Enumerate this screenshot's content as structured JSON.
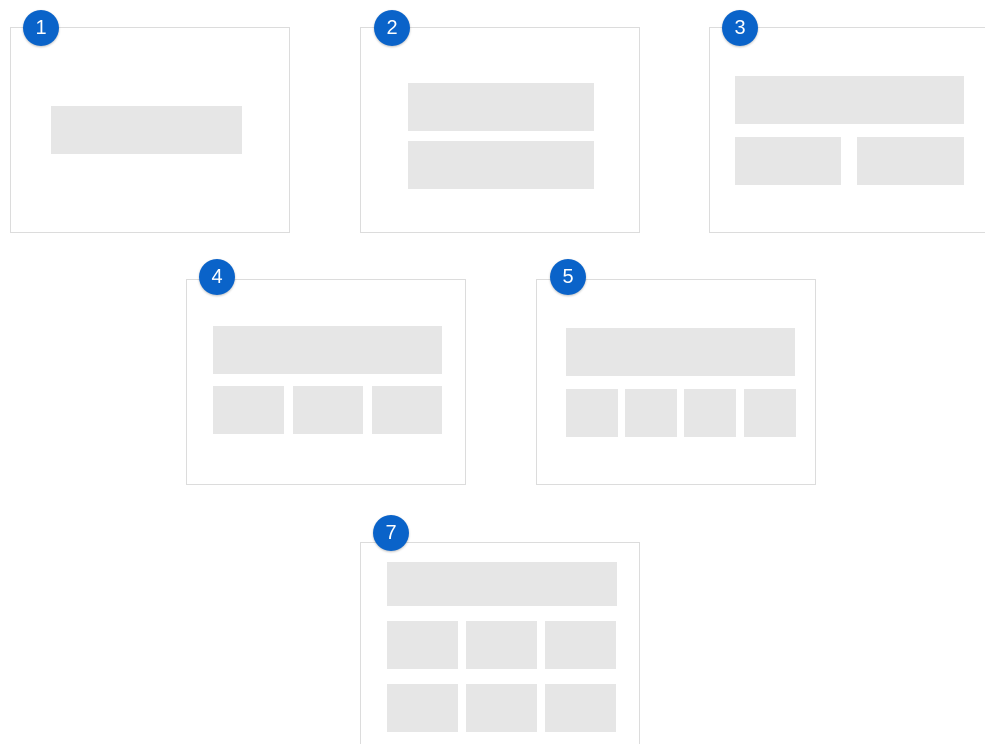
{
  "colors": {
    "badge": "#0a63c9",
    "badge_text": "#ffffff",
    "card_border": "#dcdcdc",
    "placeholder_block": "#e6e6e6",
    "background": "#ffffff"
  },
  "layouts": [
    {
      "number": "1",
      "description_rows": [
        1
      ]
    },
    {
      "number": "2",
      "description_rows": [
        1,
        1
      ]
    },
    {
      "number": "3",
      "description_rows": [
        1,
        2
      ]
    },
    {
      "number": "4",
      "description_rows": [
        1,
        3
      ]
    },
    {
      "number": "5",
      "description_rows": [
        1,
        4
      ]
    },
    {
      "number": "7",
      "description_rows": [
        1,
        3,
        3
      ]
    }
  ]
}
